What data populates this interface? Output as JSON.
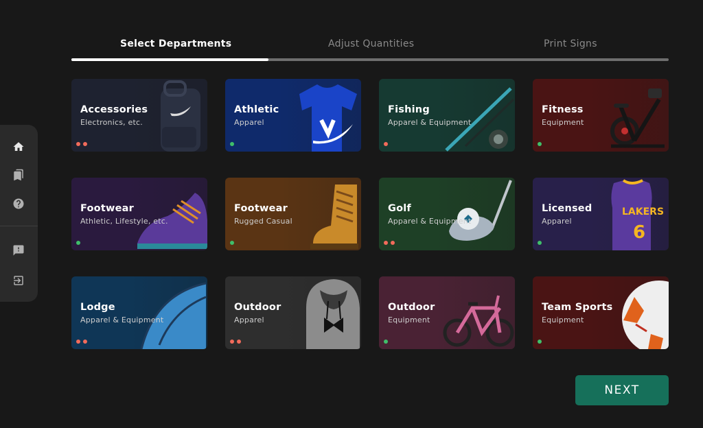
{
  "steps": {
    "step1": "Select Departments",
    "step2": "Adjust Quantities",
    "step3": "Print Signs",
    "progress": 0.33
  },
  "sidebar": {
    "items": [
      {
        "icon": "home-icon"
      },
      {
        "icon": "bookmarks-icon"
      },
      {
        "icon": "help-icon"
      },
      {
        "icon": "feedback-icon"
      },
      {
        "icon": "logout-icon"
      }
    ]
  },
  "departments": [
    {
      "title": "Accessories",
      "subtitle": "Electronics, etc.",
      "status": [
        "red",
        "red"
      ],
      "bg": "#1e2230",
      "image": "backpack"
    },
    {
      "title": "Athletic",
      "subtitle": "Apparel",
      "status": [
        "green"
      ],
      "bg": "#0f2a6b",
      "image": "tshirt"
    },
    {
      "title": "Fishing",
      "subtitle": "Apparel & Equipment",
      "status": [
        "red"
      ],
      "bg": "#163a32",
      "image": "fishing-rod"
    },
    {
      "title": "Fitness",
      "subtitle": "Equipment",
      "status": [
        "green"
      ],
      "bg": "#4a1414",
      "image": "exercise-bike"
    },
    {
      "title": "Footwear",
      "subtitle": "Athletic, Lifestyle, etc.",
      "status": [
        "green"
      ],
      "bg": "#2a1a3e",
      "image": "sneaker"
    },
    {
      "title": "Footwear",
      "subtitle": "Rugged Casual",
      "status": [
        "green"
      ],
      "bg": "#5a3414",
      "image": "boot"
    },
    {
      "title": "Golf",
      "subtitle": "Apparel & Equipment",
      "status": [
        "red",
        "red"
      ],
      "bg": "#1e4026",
      "image": "golf-club"
    },
    {
      "title": "Licensed",
      "subtitle": "Apparel",
      "status": [
        "green"
      ],
      "bg": "#28204a",
      "image": "jersey"
    },
    {
      "title": "Lodge",
      "subtitle": "Apparel & Equipment",
      "status": [
        "red",
        "red"
      ],
      "bg": "#0f3656",
      "image": "tent"
    },
    {
      "title": "Outdoor",
      "subtitle": "Apparel",
      "status": [
        "red",
        "red"
      ],
      "bg": "#2e2e2e",
      "image": "hoodie"
    },
    {
      "title": "Outdoor",
      "subtitle": "Equipment",
      "status": [
        "green"
      ],
      "bg": "#4a2234",
      "image": "bicycle"
    },
    {
      "title": "Team Sports",
      "subtitle": "Equipment",
      "status": [
        "green"
      ],
      "bg": "#4a1414",
      "image": "soccer-ball"
    }
  ],
  "next_label": "NEXT"
}
